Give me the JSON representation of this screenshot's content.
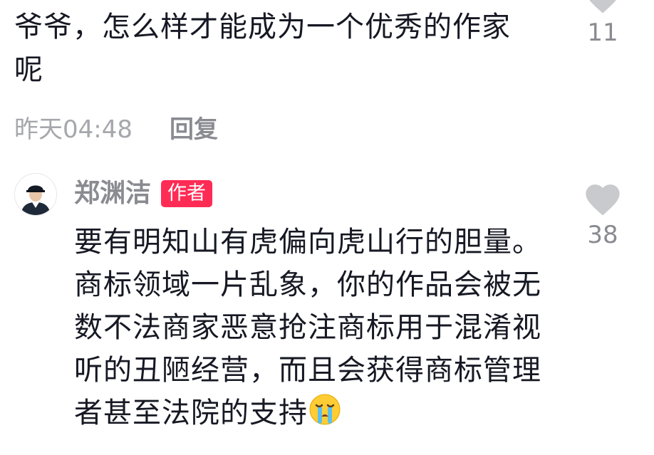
{
  "top_comment": {
    "text": "爷爷，怎么样才能成为一个优秀的作家呢",
    "time": "昨天04:48",
    "reply_label": "回复",
    "like_count": "11"
  },
  "reply": {
    "author": "郑渊洁",
    "author_tag": "作者",
    "text": "要有明知山有虎偏向虎山行的胆量。商标领域一片乱象，你的作品会被无数不法商家恶意抢注商标用于混淆视听的丑陋经营，而且会获得商标管理者甚至法院的支持",
    "emoji": "crying-face-emoji",
    "like_count": "38"
  },
  "icons": {
    "like": "heart-icon",
    "avatar": "avatar"
  },
  "colors": {
    "text": "#161823",
    "muted": "#8a8b91",
    "time": "#a6a7ac",
    "heart": "#c9cacd",
    "author_tag_bg": "#fe2c55"
  }
}
